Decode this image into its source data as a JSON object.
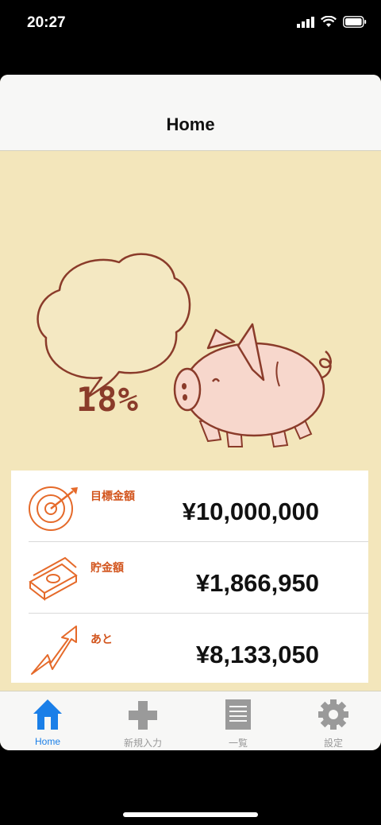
{
  "status_bar": {
    "time": "20:27"
  },
  "nav": {
    "title": "Home"
  },
  "hero": {
    "percent": "18%"
  },
  "summary": [
    {
      "label": "目標金額",
      "amount": "¥10,000,000",
      "icon": "target-icon"
    },
    {
      "label": "貯金額",
      "amount": "¥1,866,950",
      "icon": "money-stack-icon"
    },
    {
      "label": "あと",
      "amount": "¥8,133,050",
      "icon": "arrow-up-icon"
    }
  ],
  "tabs": [
    {
      "label": "Home",
      "icon": "home-icon",
      "active": true
    },
    {
      "label": "新規入力",
      "icon": "plus-icon",
      "active": false
    },
    {
      "label": "一覧",
      "icon": "list-icon",
      "active": false
    },
    {
      "label": "設定",
      "icon": "gear-icon",
      "active": false
    }
  ],
  "colors": {
    "accent": "#1a7fe8",
    "label": "#d2541c",
    "background": "#f3e6bb"
  }
}
